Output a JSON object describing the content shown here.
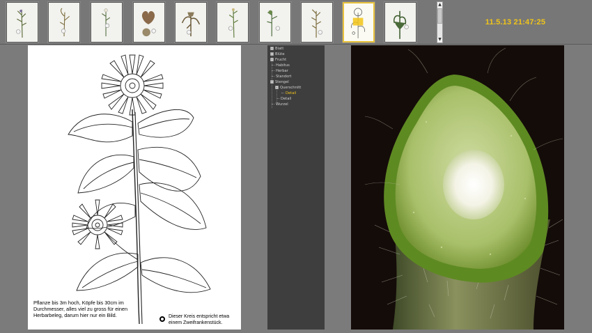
{
  "header": {
    "datetime": "11.5.13 21:47:25",
    "thumbnails": [
      {
        "name": "herbarium-thumb-1",
        "selected": false
      },
      {
        "name": "herbarium-thumb-2",
        "selected": false
      },
      {
        "name": "herbarium-thumb-3",
        "selected": false
      },
      {
        "name": "herbarium-thumb-4",
        "selected": false
      },
      {
        "name": "herbarium-thumb-5",
        "selected": false
      },
      {
        "name": "herbarium-thumb-6",
        "selected": false
      },
      {
        "name": "herbarium-thumb-7",
        "selected": false
      },
      {
        "name": "herbarium-thumb-8",
        "selected": false
      },
      {
        "name": "herbarium-thumb-9",
        "selected": true
      },
      {
        "name": "herbarium-thumb-10",
        "selected": false
      }
    ]
  },
  "tree": {
    "items": [
      {
        "label": "Blatt",
        "expandable": true,
        "active": false
      },
      {
        "label": "Blüte",
        "expandable": true,
        "active": false
      },
      {
        "label": "Frucht",
        "expandable": true,
        "active": false
      },
      {
        "label": "Habitus",
        "expandable": false,
        "active": false
      },
      {
        "label": "Herbar",
        "expandable": false,
        "active": false
      },
      {
        "label": "Standort",
        "expandable": false,
        "active": false
      },
      {
        "label": "Stengel",
        "expandable": true,
        "active": false
      },
      {
        "label": "Querschnitt",
        "expandable": true,
        "active": false
      },
      {
        "label": "Detail",
        "expandable": false,
        "active": true
      },
      {
        "label": "Detail",
        "expandable": false,
        "active": false
      },
      {
        "label": "Wurzel",
        "expandable": false,
        "active": false
      }
    ]
  },
  "drawing": {
    "caption": "Pflanze bis 3m hoch, Köpfe bis 30cm im Durchmesser, alles viel zu gross für einen Herbarbeleg, darum hier nur ein Bild.",
    "coin_note": "Dieser Kreis entspricht etwa einem Zweifrankenstück."
  },
  "colors": {
    "accent": "#f0c419",
    "background": "#7b7b7b",
    "tree_background": "#3e3e3e"
  }
}
